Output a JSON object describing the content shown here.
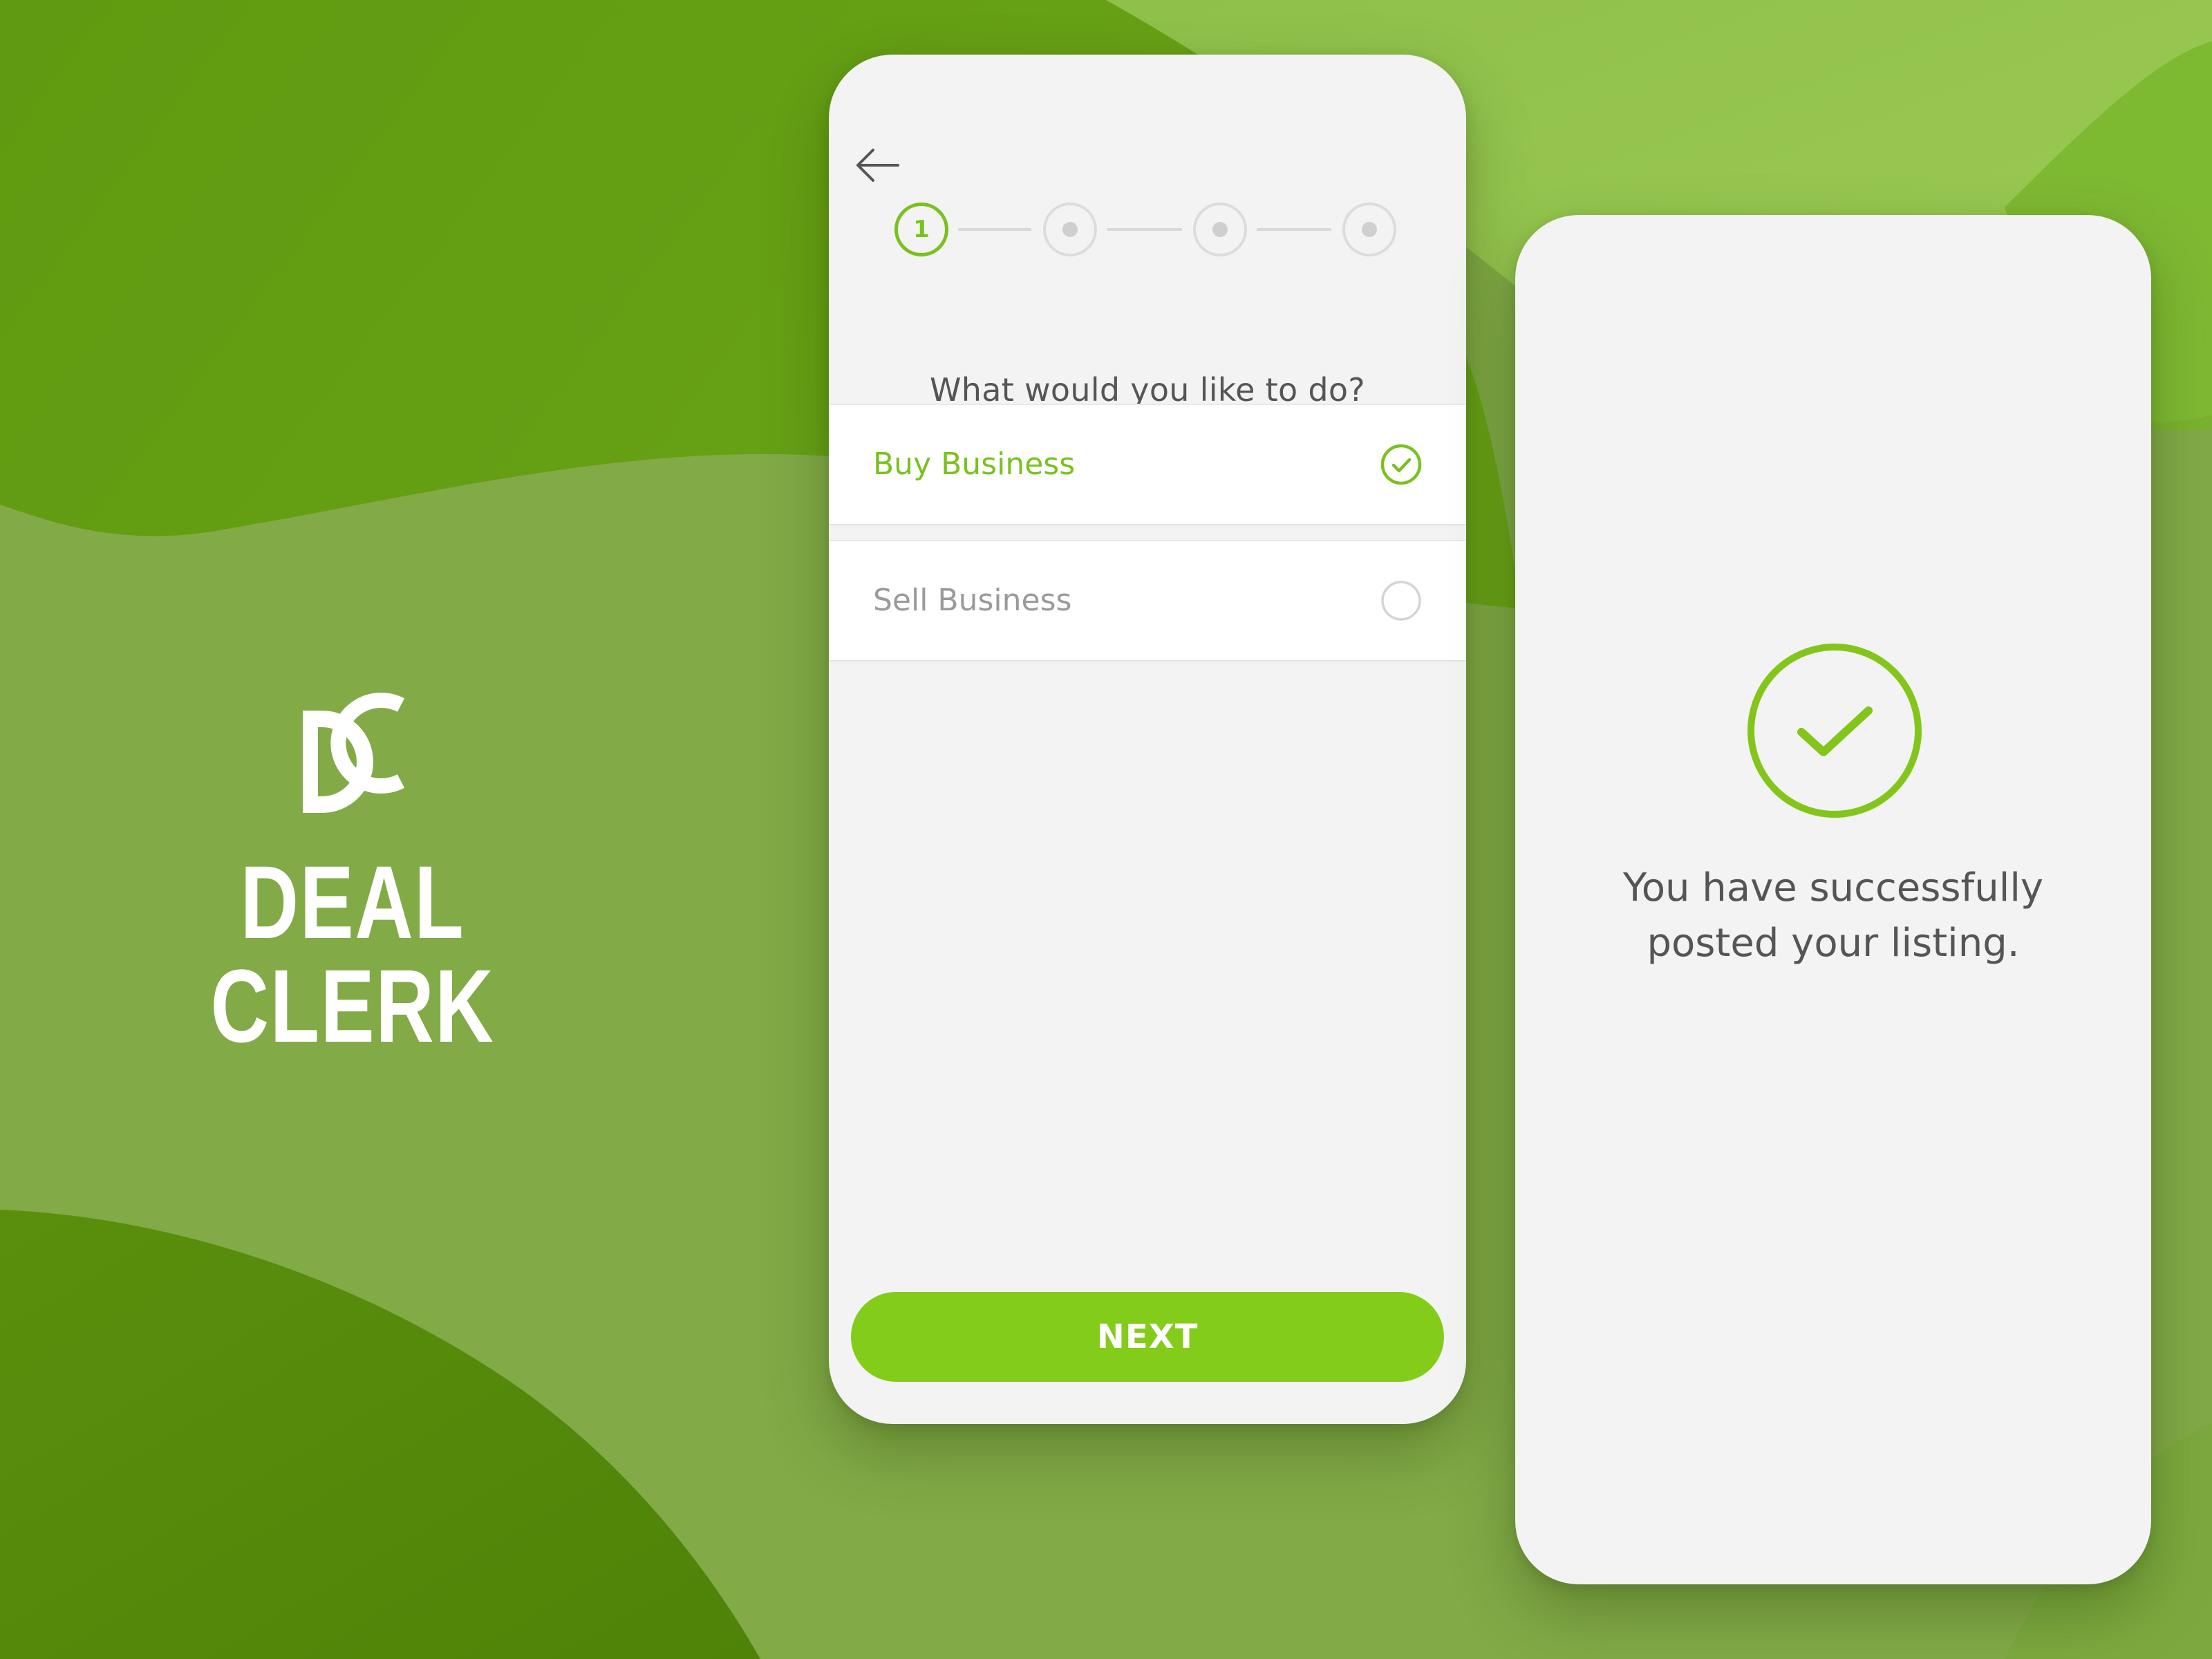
{
  "brand": {
    "monogram": "DC",
    "name": "DEAL CLERK"
  },
  "colors": {
    "accent": "#84cc1a",
    "accent_stroke": "#7ac11f",
    "background": "#80a845",
    "background_dark": "#5a8f0e",
    "screen": "#f3f3f3",
    "text": "#555555",
    "muted_text": "#9a9a9a"
  },
  "wizard": {
    "back_icon": "arrow-left-icon",
    "steps": [
      {
        "label": "1",
        "state": "active"
      },
      {
        "label": "",
        "state": "inactive"
      },
      {
        "label": "",
        "state": "inactive"
      },
      {
        "label": "",
        "state": "inactive"
      }
    ],
    "question": "What would you like to do?",
    "options": [
      {
        "label": "Buy Business",
        "selected": true,
        "icon": "check-circle-icon"
      },
      {
        "label": "Sell Business",
        "selected": false,
        "icon": "radio-empty-icon"
      }
    ],
    "next_label": "NEXT"
  },
  "success": {
    "icon": "check-circle-icon",
    "line1": "You have successfully",
    "line2": "posted your listing."
  }
}
